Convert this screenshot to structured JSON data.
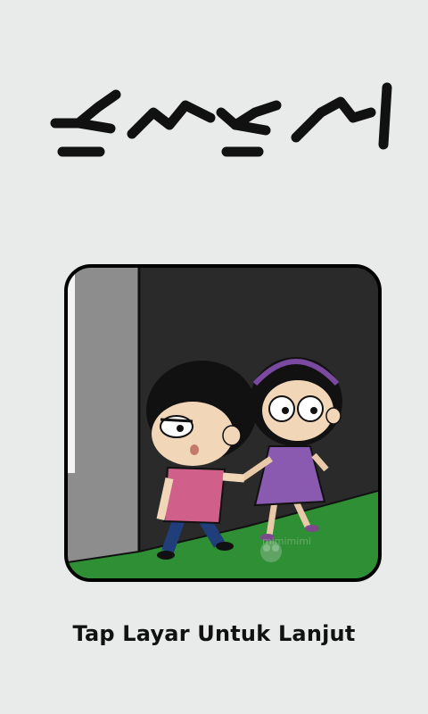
{
  "screen": {
    "tap_label": "Tap Layar Untuk Lanjut",
    "logo_script": "ꦱꦼꦩꦸꦮꦤ",
    "watermark": "mimimimi"
  },
  "colors": {
    "background": "#e9eaea",
    "wall": "#888888",
    "dark": "#2a2a2a",
    "grass": "#2e8b2e",
    "shirt_pink": "#d0608a",
    "dress_purple": "#8a5ab0"
  },
  "icons": [
    "javanese-script-logo",
    "owl-watermark-icon"
  ]
}
